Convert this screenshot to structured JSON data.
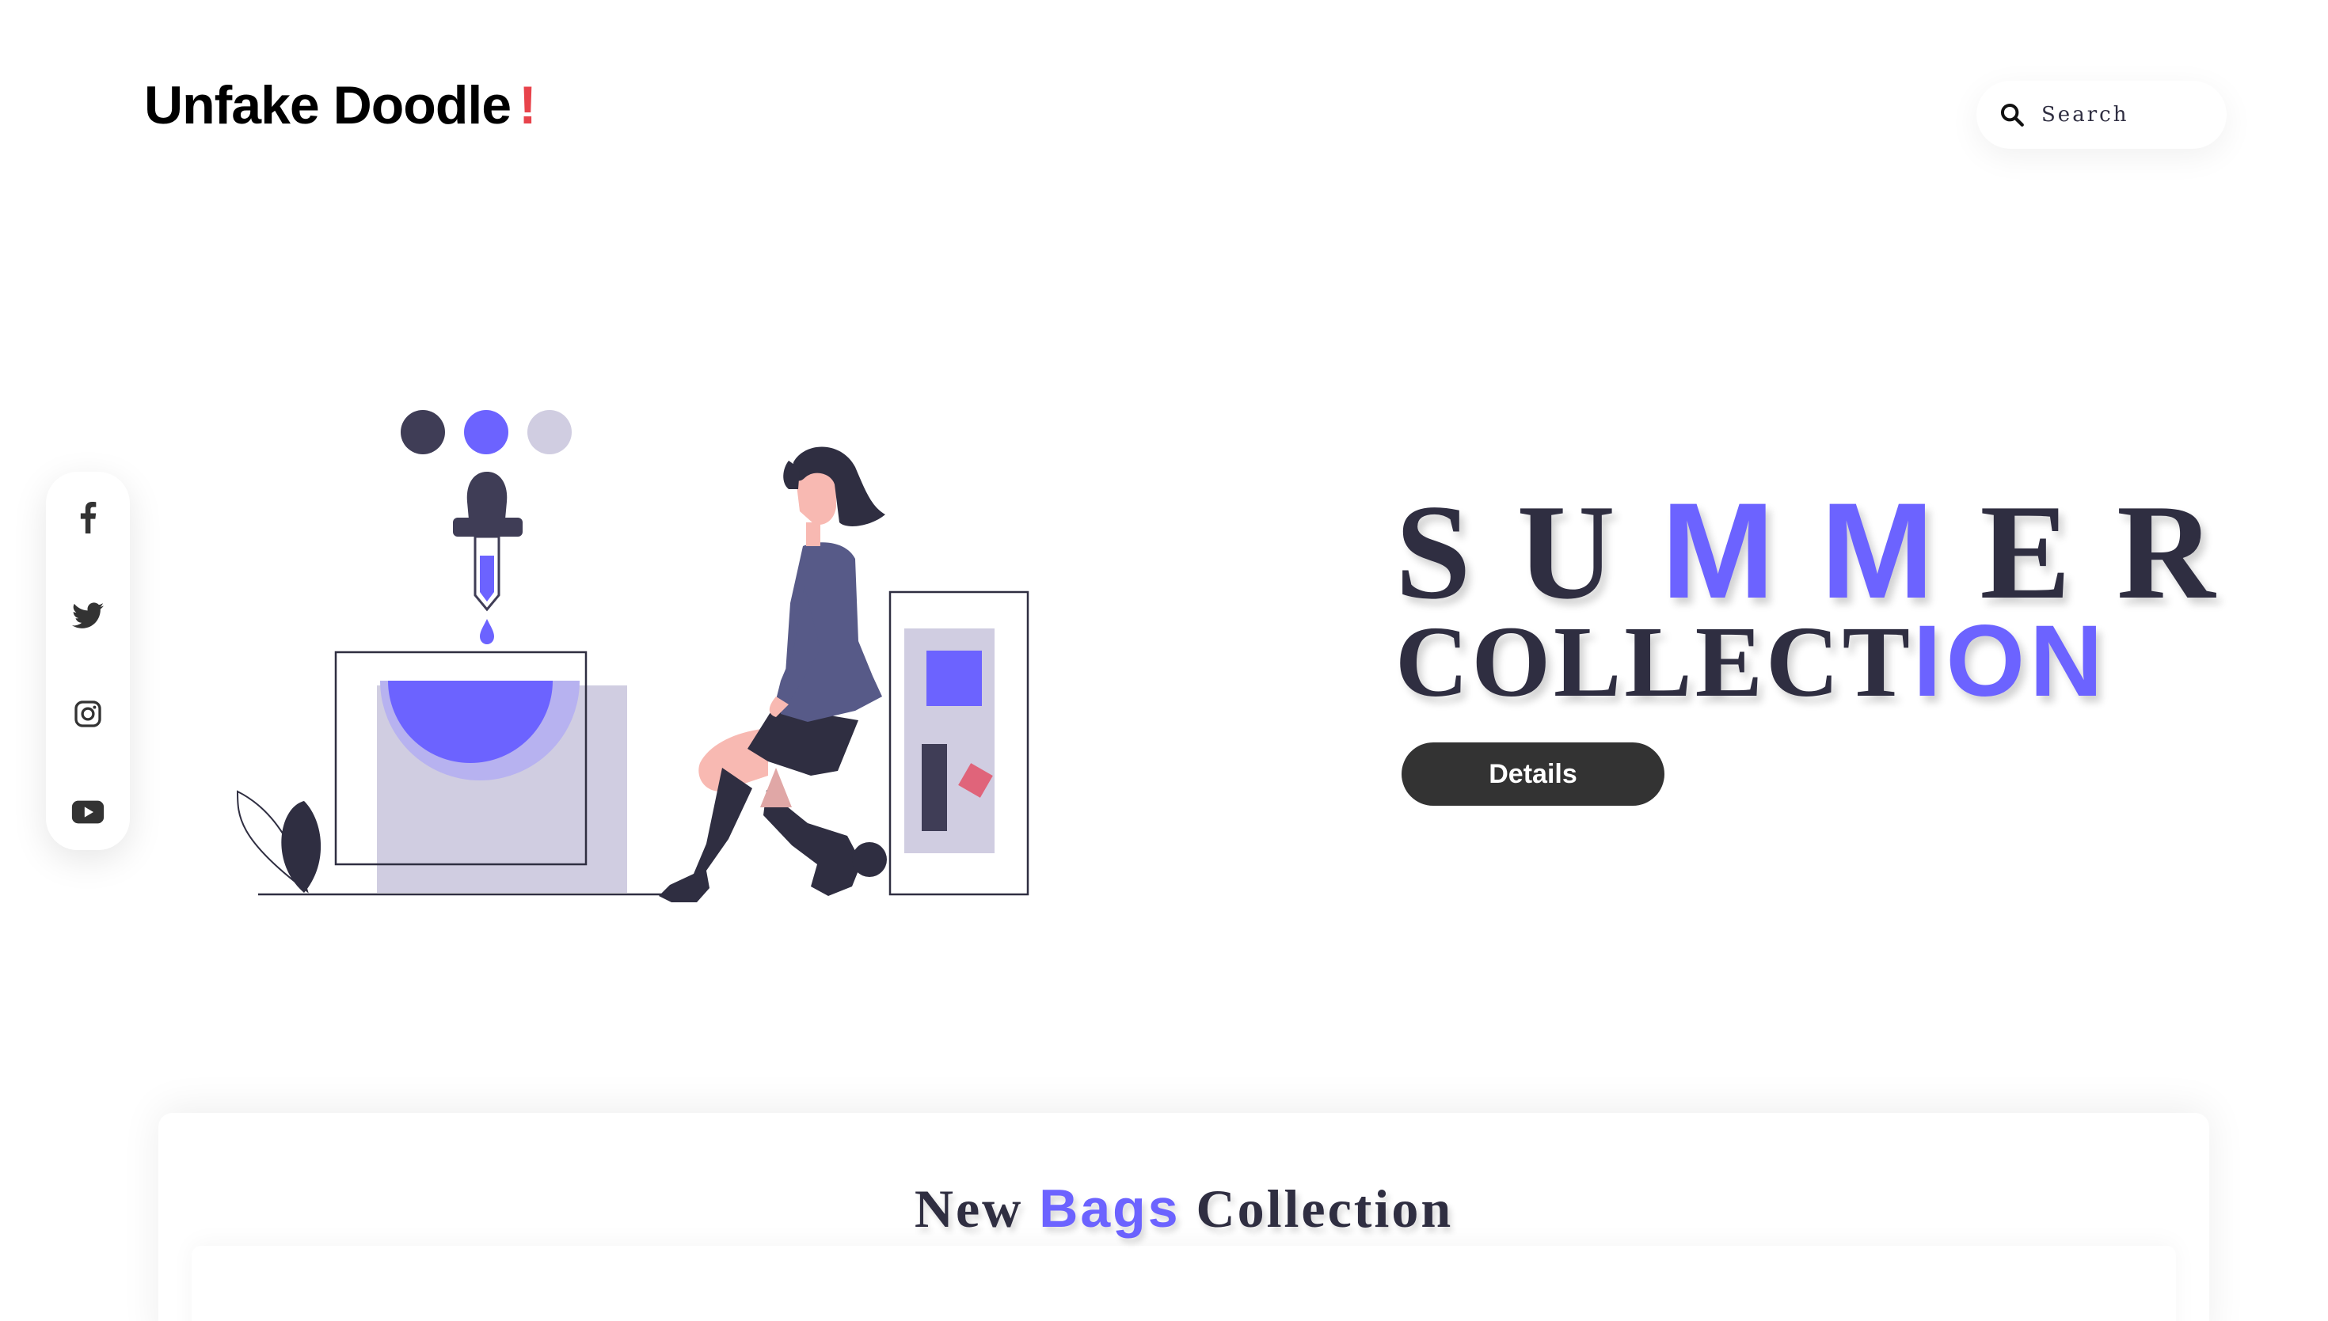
{
  "header": {
    "logo_text": "Unfake Doodle",
    "logo_mark": "!",
    "logo_mark_color": "#e8434b"
  },
  "search": {
    "placeholder": "Search",
    "icon": "search-icon"
  },
  "social": {
    "items": [
      {
        "name": "facebook",
        "icon": "facebook-icon"
      },
      {
        "name": "twitter",
        "icon": "twitter-icon"
      },
      {
        "name": "instagram",
        "icon": "instagram-icon"
      },
      {
        "name": "youtube",
        "icon": "youtube-icon"
      }
    ]
  },
  "hero": {
    "title_line1": {
      "before": "SU",
      "highlight": "MM",
      "after": "ER"
    },
    "title_line2": {
      "before": "COLLECT",
      "highlight": "ION"
    },
    "details_label": "Details"
  },
  "bags_section": {
    "title": {
      "before": "New ",
      "highlight": "Bags",
      "after": " Collection"
    }
  },
  "colors": {
    "accent": "#6c63ff",
    "dark": "#2f2e41",
    "button": "#333333",
    "lilac": "#d0cde1",
    "pink": "#e0647a"
  }
}
